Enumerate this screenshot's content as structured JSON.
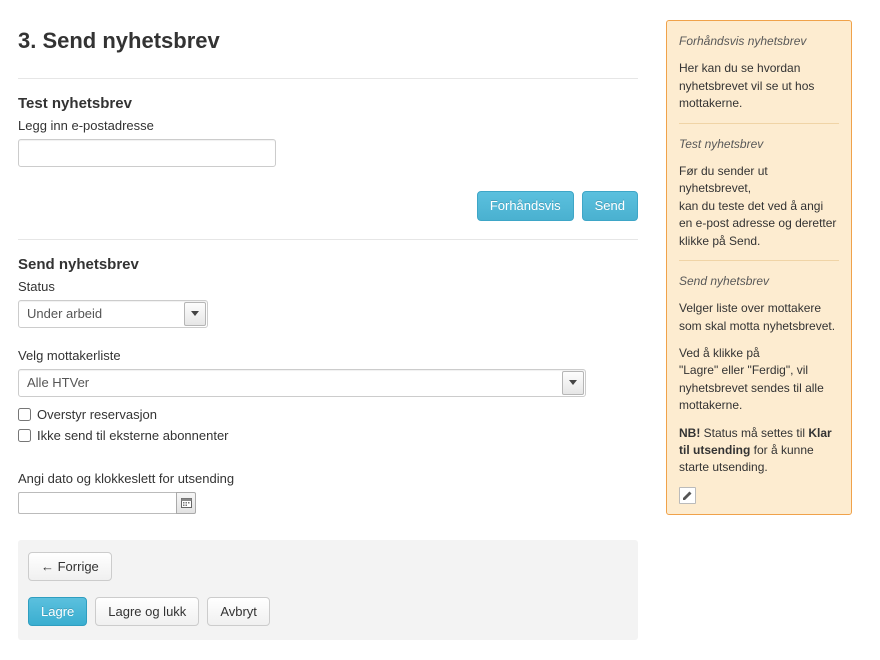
{
  "page": {
    "title": "3. Send nyhetsbrev"
  },
  "test_section": {
    "heading": "Test nyhetsbrev",
    "email_label": "Legg inn e-postadresse",
    "email_value": "",
    "preview_btn": "Forhåndsvis",
    "send_btn": "Send"
  },
  "send_section": {
    "heading": "Send nyhetsbrev",
    "status_label": "Status",
    "status_value": "Under arbeid",
    "list_label": "Velg mottakerliste",
    "list_value": "Alle HTVer",
    "override_label": "Overstyr reservasjon",
    "no_external_label": "Ikke send til eksterne abonnenter",
    "datetime_label": "Angi dato og klokkeslett for utsending",
    "datetime_value": ""
  },
  "footer": {
    "prev": "← Forrige",
    "save": "Lagre",
    "save_close": "Lagre og lukk",
    "cancel": "Avbryt"
  },
  "help": {
    "preview": {
      "heading": "Forhåndsvis nyhetsbrev",
      "body": "Her kan du se hvordan nyhetsbrevet vil se ut hos mottakerne."
    },
    "test": {
      "heading": "Test nyhetsbrev",
      "line1": "Før du sender ut nyhetsbrevet,",
      "line2": "kan du teste det ved å angi en e-post adresse og deretter",
      "line3": "klikke på Send."
    },
    "send": {
      "heading": "Send nyhetsbrev",
      "body1": "Velger liste over mottakere som skal motta nyhetsbrevet.",
      "body2a": "Ved å klikke på",
      "body2b": "\"Lagre\" eller \"Ferdig\", vil nyhetsbrevet sendes til alle",
      "body2c": "mottakerne.",
      "nb_prefix": "NB!",
      "nb_mid1": " Status må settes til ",
      "nb_strong": "Klar til utsending",
      "nb_mid2": " for å kunne starte utsending."
    }
  }
}
